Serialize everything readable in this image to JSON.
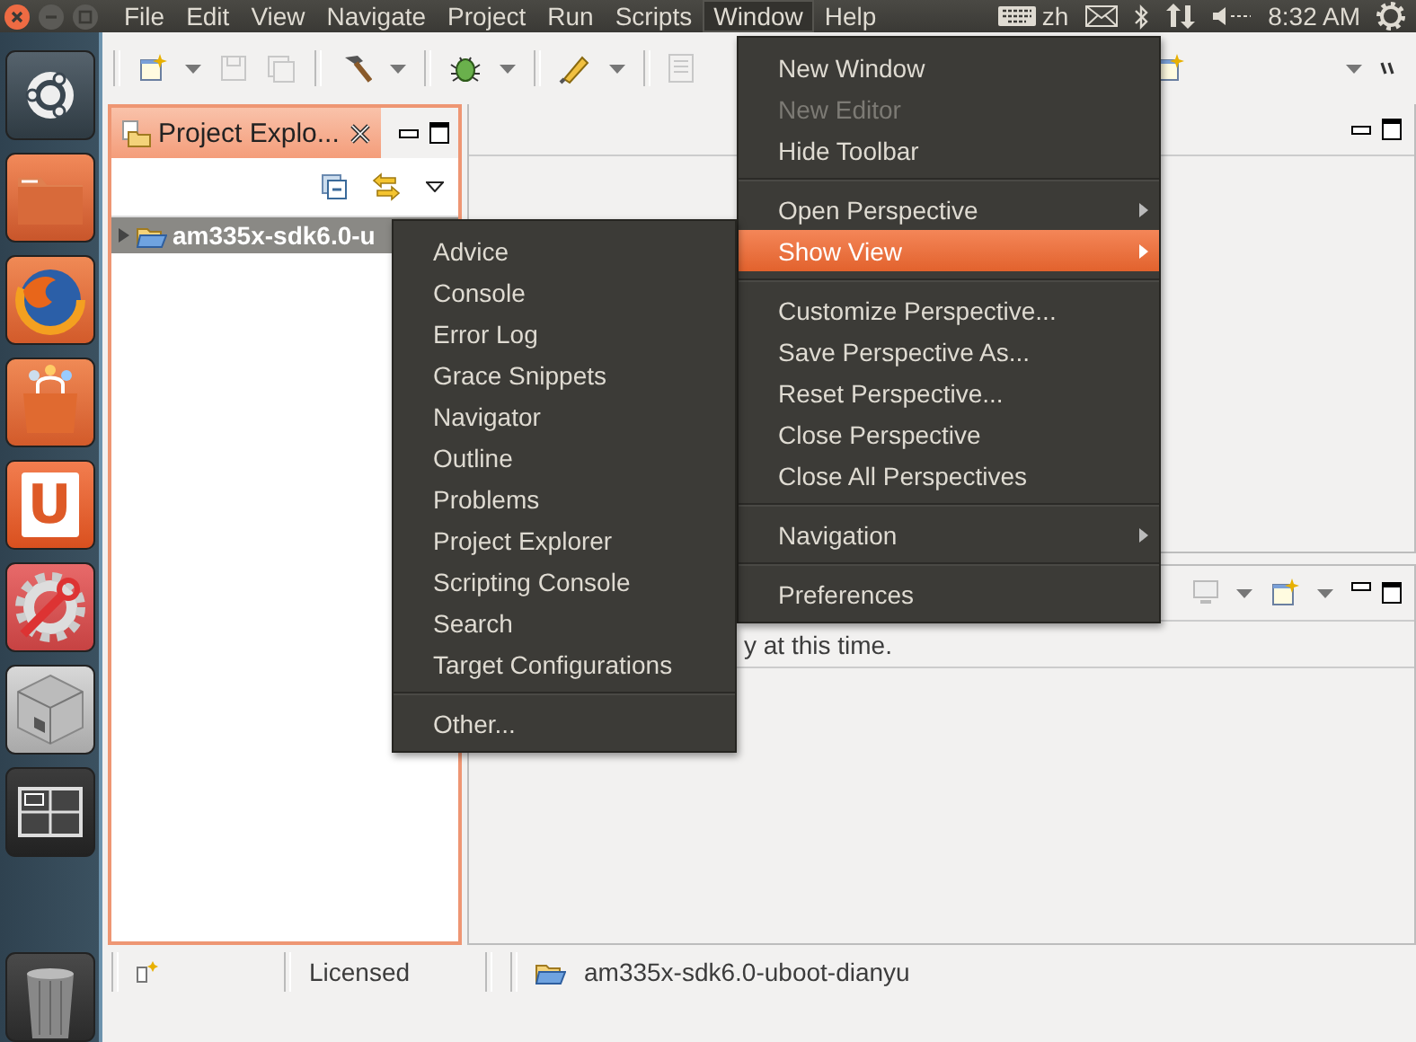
{
  "menu_bar": [
    {
      "label": "File",
      "selected": false
    },
    {
      "label": "Edit",
      "selected": false
    },
    {
      "label": "View",
      "selected": false
    },
    {
      "label": "Navigate",
      "selected": false
    },
    {
      "label": "Project",
      "selected": false
    },
    {
      "label": "Run",
      "selected": false
    },
    {
      "label": "Scripts",
      "selected": false
    },
    {
      "label": "Window",
      "selected": true
    },
    {
      "label": "Help",
      "selected": false
    }
  ],
  "indicators": {
    "keyboard_layout": "zh",
    "clock": "8:32 AM"
  },
  "launcher": {
    "app_letter": "U"
  },
  "project_explorer": {
    "title": "Project Explo...",
    "tree": [
      {
        "label": "am335x-sdk6.0-u",
        "selected": true,
        "expanded": false
      }
    ]
  },
  "console": {
    "message": "y at this time."
  },
  "status_bar": {
    "license": "Licensed",
    "project": "am335x-sdk6.0-uboot-dianyu"
  },
  "window_menu": {
    "items": [
      {
        "kind": "item",
        "label": "New Window",
        "disabled": false,
        "submenu": false,
        "selected": false
      },
      {
        "kind": "item",
        "label": "New Editor",
        "disabled": true,
        "submenu": false,
        "selected": false
      },
      {
        "kind": "item",
        "label": "Hide Toolbar",
        "disabled": false,
        "submenu": false,
        "selected": false
      },
      {
        "kind": "separator"
      },
      {
        "kind": "item",
        "label": "Open Perspective",
        "disabled": false,
        "submenu": true,
        "selected": false
      },
      {
        "kind": "item",
        "label": "Show View",
        "disabled": false,
        "submenu": true,
        "selected": true
      },
      {
        "kind": "separator"
      },
      {
        "kind": "item",
        "label": "Customize Perspective...",
        "disabled": false,
        "submenu": false,
        "selected": false
      },
      {
        "kind": "item",
        "label": "Save Perspective As...",
        "disabled": false,
        "submenu": false,
        "selected": false
      },
      {
        "kind": "item",
        "label": "Reset Perspective...",
        "disabled": false,
        "submenu": false,
        "selected": false
      },
      {
        "kind": "item",
        "label": "Close Perspective",
        "disabled": false,
        "submenu": false,
        "selected": false
      },
      {
        "kind": "item",
        "label": "Close All Perspectives",
        "disabled": false,
        "submenu": false,
        "selected": false
      },
      {
        "kind": "separator"
      },
      {
        "kind": "item",
        "label": "Navigation",
        "disabled": false,
        "submenu": true,
        "selected": false
      },
      {
        "kind": "separator"
      },
      {
        "kind": "item",
        "label": "Preferences",
        "disabled": false,
        "submenu": false,
        "selected": false
      }
    ]
  },
  "show_view_menu": {
    "items": [
      {
        "kind": "item",
        "label": "Advice"
      },
      {
        "kind": "item",
        "label": "Console"
      },
      {
        "kind": "item",
        "label": "Error Log"
      },
      {
        "kind": "item",
        "label": "Grace Snippets"
      },
      {
        "kind": "item",
        "label": "Navigator"
      },
      {
        "kind": "item",
        "label": "Outline"
      },
      {
        "kind": "item",
        "label": "Problems"
      },
      {
        "kind": "item",
        "label": "Project Explorer"
      },
      {
        "kind": "item",
        "label": "Scripting Console"
      },
      {
        "kind": "item",
        "label": "Search"
      },
      {
        "kind": "item",
        "label": "Target Configurations"
      },
      {
        "kind": "separator"
      },
      {
        "kind": "item",
        "label": "Other..."
      }
    ]
  }
}
